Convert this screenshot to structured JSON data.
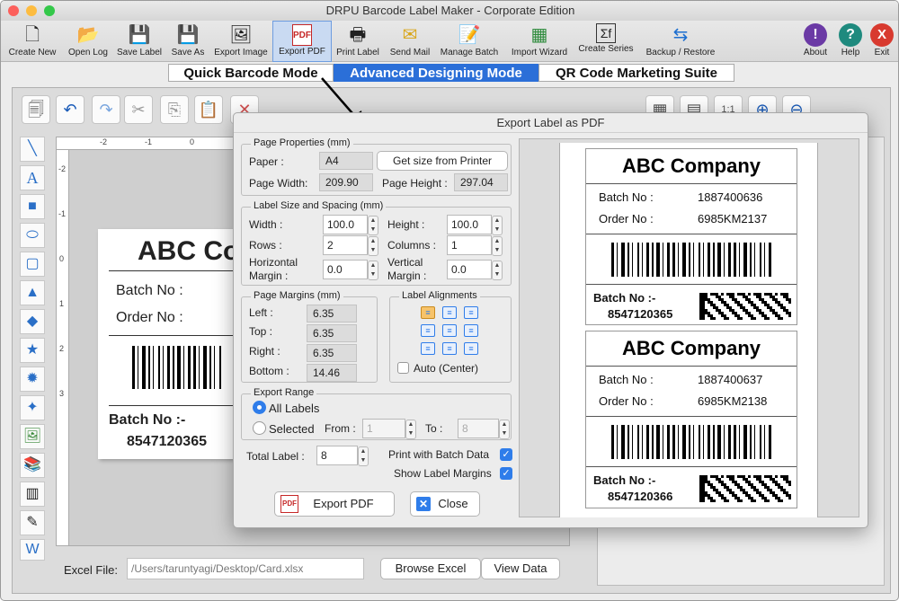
{
  "window": {
    "title": "DRPU Barcode Label Maker - Corporate Edition"
  },
  "toolbar": {
    "items": [
      {
        "label": "Create New",
        "icon": "new-file-icon"
      },
      {
        "label": "Open Log",
        "icon": "open-folder-icon"
      },
      {
        "label": "Save Label",
        "icon": "save-icon"
      },
      {
        "label": "Save As",
        "icon": "save-as-icon"
      },
      {
        "label": "Export Image",
        "icon": "export-image-icon"
      },
      {
        "label": "Export PDF",
        "icon": "pdf-icon"
      },
      {
        "label": "Print Label",
        "icon": "printer-icon"
      },
      {
        "label": "Send Mail",
        "icon": "mail-icon"
      },
      {
        "label": "Manage Batch",
        "icon": "batch-icon"
      },
      {
        "label": "Import Wizard",
        "icon": "import-icon"
      },
      {
        "label": "Create Series",
        "icon": "series-icon"
      },
      {
        "label": "Backup / Restore",
        "icon": "backup-icon"
      }
    ],
    "right": [
      {
        "label": "About",
        "icon": "info-icon",
        "color": "#6b3aa5"
      },
      {
        "label": "Help",
        "icon": "help-icon",
        "color": "#1f8a7e"
      },
      {
        "label": "Exit",
        "icon": "close-icon",
        "color": "#d83a2f"
      }
    ]
  },
  "modes": {
    "quick": "Quick Barcode Mode",
    "advanced": "Advanced Designing Mode",
    "qr": "QR Code Marketing Suite"
  },
  "canvas_label": {
    "company": "ABC Co",
    "batch_label": "Batch No :",
    "order_label": "Order No :",
    "batch_footer_label": "Batch No :-",
    "batch_footer_value": "8547120365"
  },
  "excel": {
    "label": "Excel File:",
    "path": "/Users/taruntyagi/Desktop/Card.xlsx",
    "browse": "Browse Excel",
    "view": "View Data"
  },
  "dialog": {
    "title": "Export Label as PDF",
    "page_props": {
      "legend": "Page Properties (mm)",
      "paper_label": "Paper :",
      "paper": "A4",
      "get_size": "Get size from Printer",
      "width_label": "Page Width:",
      "width": "209.90",
      "height_label": "Page Height :",
      "height": "297.04"
    },
    "size_spacing": {
      "legend": "Label Size and Spacing (mm)",
      "width_label": "Width :",
      "width": "100.0",
      "height_label": "Height :",
      "height": "100.0",
      "rows_label": "Rows :",
      "rows": "2",
      "cols_label": "Columns :",
      "cols": "1",
      "hmargin_label_1": "Horizontal",
      "hmargin_label_2": "Margin :",
      "hmargin": "0.0",
      "vmargin_label_1": "Vertical",
      "vmargin_label_2": "Margin :",
      "vmargin": "0.0"
    },
    "margins": {
      "legend": "Page Margins (mm)",
      "left_label": "Left :",
      "left": "6.35",
      "top_label": "Top :",
      "top": "6.35",
      "right_label": "Right :",
      "right": "6.35",
      "bottom_label": "Bottom :",
      "bottom": "14.46"
    },
    "alignments": {
      "legend": "Label Alignments",
      "auto": "Auto (Center)"
    },
    "range": {
      "legend": "Export Range",
      "all": "All Labels",
      "selected": "Selected",
      "from_label": "From :",
      "from": "1",
      "to_label": "To :",
      "to": "8"
    },
    "total_label": "Total Label :",
    "total": "8",
    "print_batch": "Print with Batch Data",
    "show_margins": "Show Label Margins",
    "export_btn": "Export PDF",
    "close_btn": "Close"
  },
  "preview": {
    "labels": [
      {
        "company": "ABC Company",
        "batch_label": "Batch No :",
        "batch": "1887400636",
        "order_label": "Order No :",
        "order": "6985KM2137",
        "footer_label": "Batch No :-",
        "footer_value": "8547120365"
      },
      {
        "company": "ABC Company",
        "batch_label": "Batch No :",
        "batch": "1887400637",
        "order_label": "Order No :",
        "order": "6985KM2138",
        "footer_label": "Batch No :-",
        "footer_value": "8547120366"
      }
    ]
  },
  "colors": {
    "accent": "#2f7dea",
    "mode_active": "#2b6fd8"
  }
}
